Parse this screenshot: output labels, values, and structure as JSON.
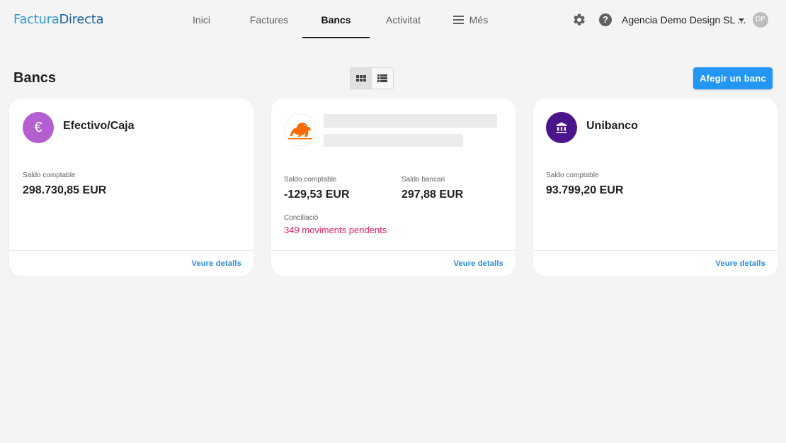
{
  "header": {
    "logo_part1": "Factura",
    "logo_part2": "Directa",
    "nav": [
      {
        "label": "Inici"
      },
      {
        "label": "Factures"
      },
      {
        "label": "Bancs"
      },
      {
        "label": "Activitat"
      },
      {
        "label": "Més"
      }
    ],
    "active_nav": "Bancs",
    "company_name": "Agencia Demo Design SL ...",
    "avatar_initials": "DP"
  },
  "page": {
    "title": "Bancs",
    "add_button_label": "Afegir un banc",
    "view_mode": "grid"
  },
  "cards": [
    {
      "name": "Efectivo/Caja",
      "icon": "euro-icon",
      "icon_color": "#b35fd0",
      "saldo_comptable_label": "Saldo comptable",
      "saldo_comptable": "298.730,85 EUR",
      "details_label": "Veure detalls"
    },
    {
      "name": "",
      "icon": "lion-logo-icon",
      "saldo_comptable_label": "Saldo comptable",
      "saldo_comptable": "-129,53 EUR",
      "saldo_bancari_label": "Saldo bancari",
      "saldo_bancari": "297,88 EUR",
      "conciliacio_label": "Conciliació",
      "conciliacio_value": "349 moviments pendents",
      "details_label": "Veure detalls"
    },
    {
      "name": "Unibanco",
      "icon": "bank-building-icon",
      "icon_color": "#4a148c",
      "saldo_comptable_label": "Saldo comptable",
      "saldo_comptable": "93.799,20 EUR",
      "details_label": "Veure detalls"
    }
  ],
  "colors": {
    "accent": "#2196f3",
    "pending": "#e91e63",
    "background": "#f4f4f4"
  }
}
